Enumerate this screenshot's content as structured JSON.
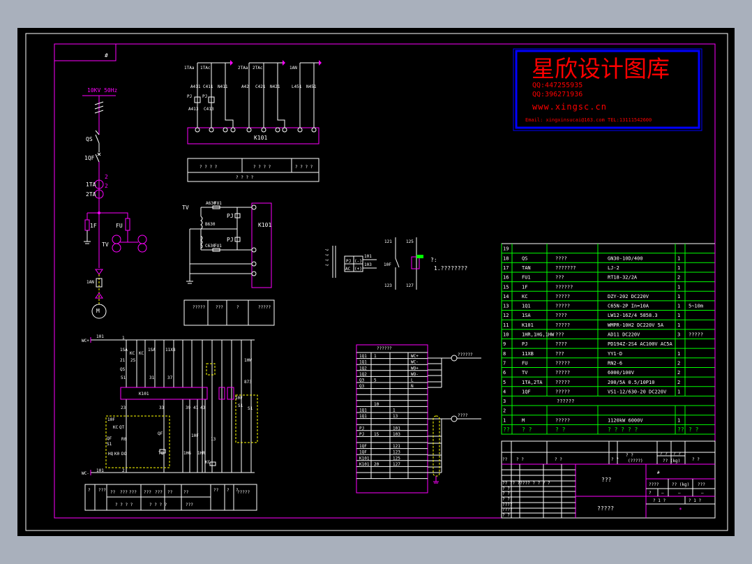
{
  "colors": {
    "background": "#a9b0bc",
    "canvas": "#000000",
    "frame": "#ff00ff",
    "lines": "#ffffff",
    "table_grid": "#00ff00",
    "watermark_text": "#ff0000",
    "watermark_border": "#0000ff",
    "dashed": "#ffff00"
  },
  "corner_label": "#",
  "watermark": {
    "title": "星欣设计图库",
    "qq1": "QQ:447255935",
    "qq2": "QQ:396271936",
    "url": "www.xingsc.cn",
    "contact": "Email: xingxinsucai@163.com   TEL:13111542600"
  },
  "single_line": {
    "bus": "10KV   50Hz",
    "qs": "QS",
    "qf": "1QF",
    "ta1": "1TA",
    "ta2": "2TA",
    "ta_n1": "2",
    "ta_n2": "2",
    "f1": "1F",
    "fu": "FU",
    "tv": "TV",
    "an": "1AN",
    "motor": "M"
  },
  "current_circuit": {
    "labels": [
      "1TAa",
      "1TAc",
      "2TAa",
      "2TAc",
      "1AN"
    ],
    "wires": [
      "A411",
      "C411",
      "N411",
      "A42",
      "C421",
      "N421",
      "L451",
      "N451"
    ],
    "pj": [
      "PJ",
      "PJ"
    ],
    "wires2": [
      "A413",
      "C413"
    ],
    "terminal_box": "K101",
    "table_row1": [
      "? ? ? ?",
      "? ? ? ?",
      "? ? ? ?"
    ],
    "table_row2": "? ? ? ?"
  },
  "voltage_circuit": {
    "tv": "TV",
    "wires": [
      "A630",
      "B630",
      "C630"
    ],
    "fu": [
      "FU1",
      "FU1"
    ],
    "pj": [
      "PJ",
      "PJ"
    ],
    "terminal_box": "K101",
    "table": [
      "?????",
      "???",
      "?",
      "?????"
    ]
  },
  "meter": {
    "side": "?  ?  ?  ?",
    "pj": "PJ",
    "ac": "AC",
    "minus": "(-)",
    "plus": "(+)",
    "w1": "101",
    "w2": "103",
    "contact_label": "10F",
    "n121": "121",
    "n123": "123",
    "n125": "125",
    "n127": "127",
    "note_title": "?:",
    "note_1": "1.????????"
  },
  "control_circuit": {
    "top_bus": "WC+",
    "bottom_bus": "WC-",
    "n101a": "101",
    "n101b": "101",
    "n1": "1",
    "n2": "2",
    "labels": [
      "1SA",
      "KC",
      "KC",
      "1SA",
      "11XB",
      "21",
      "25",
      "QS",
      "51",
      "31",
      "37",
      "K101",
      "23",
      "33",
      "39",
      "41",
      "43",
      "10F",
      "KC",
      "QT",
      "QF",
      "S1",
      "R0",
      "HQ",
      "K0",
      "DO",
      "QF",
      "TQ",
      "1HG",
      "1HR",
      "KC",
      "10F",
      "13",
      "1HW",
      "873",
      "S1",
      "S1",
      "10F"
    ],
    "table_row1": [
      "?",
      "???",
      "??",
      "???",
      "???",
      "???",
      "???",
      "??",
      "??",
      "??",
      "?",
      "?",
      "?????"
    ],
    "table_row2": [
      "? ? ? ?",
      "? ? ? ?",
      "???"
    ]
  },
  "terminal_table": {
    "title": "??????",
    "rows": [
      [
        "1Q1",
        "1",
        "",
        "WC+"
      ],
      [
        "1Q1",
        "",
        "",
        "WC-"
      ],
      [
        "1Q2",
        "",
        "",
        "WO+"
      ],
      [
        "1Q2",
        "",
        "",
        "WO-"
      ],
      [
        "Q3",
        "5",
        "",
        "L"
      ],
      [
        "Q3",
        "",
        "",
        "N"
      ],
      [
        "",
        "",
        "",
        ""
      ],
      [
        "",
        "",
        "",
        ""
      ],
      [
        "",
        "10",
        "",
        ""
      ],
      [
        "1Q1",
        "",
        "1",
        ""
      ],
      [
        "1Q1",
        "",
        "13",
        ""
      ],
      [
        "",
        "",
        "",
        ""
      ],
      [
        "PJ",
        "",
        "101",
        ""
      ],
      [
        "PJ",
        "15",
        "103",
        ""
      ],
      [
        "",
        "",
        "",
        ""
      ],
      [
        "1QF",
        "",
        "121",
        ""
      ],
      [
        "1QF",
        "",
        "123",
        ""
      ],
      [
        "K101",
        "",
        "125",
        ""
      ],
      [
        "K101",
        "20",
        "127",
        ""
      ],
      [
        "",
        "",
        "",
        ""
      ],
      [
        "",
        "",
        "",
        ""
      ]
    ],
    "cable1": "??????",
    "cable2": "????"
  },
  "bom": {
    "rows": [
      [
        "19",
        "",
        "",
        "",
        "",
        ""
      ],
      [
        "18",
        "QS",
        "????",
        "GN30-10D/400",
        "1",
        ""
      ],
      [
        "17",
        "TAN",
        "???????",
        "LJ-2",
        "1",
        ""
      ],
      [
        "16",
        "FU1",
        "???",
        "RT18-32/2A",
        "2",
        ""
      ],
      [
        "15",
        "1F",
        "??????",
        "",
        "1",
        ""
      ],
      [
        "14",
        "KC",
        "?????",
        "DZY-202   DC220V",
        "1",
        ""
      ],
      [
        "13",
        "1Q1",
        "?????",
        "C65N-2P   In=10A",
        "1",
        "5~10m"
      ],
      [
        "12",
        "1SA",
        "????",
        "LW12-16Z/4 5858.3",
        "1",
        ""
      ],
      [
        "11",
        "K101",
        "?????",
        "WMPR-10H2 DC220V 5A",
        "1",
        ""
      ],
      [
        "10",
        "1HR,1HG,1HW",
        "???",
        "AD11   DC220V",
        "3",
        "?????"
      ],
      [
        "9",
        "PJ",
        "????",
        "PD194Z-2S4 AC100V AC5A",
        "",
        ""
      ],
      [
        "8",
        "11XB",
        "???",
        "YY1-D",
        "1",
        ""
      ],
      [
        "7",
        "FU",
        "?????",
        "RN2-6",
        "2",
        ""
      ],
      [
        "6",
        "TV",
        "?????",
        "6000/100V",
        "2",
        ""
      ],
      [
        "5",
        "1TA,2TA",
        "?????",
        "200/5A 0.5/10P10",
        "2",
        ""
      ],
      [
        "4",
        "1QF",
        "?????",
        "VS1-12/630-20 DC220V",
        "1",
        ""
      ],
      [
        "3",
        "??????",
        "",
        "",
        "",
        ""
      ],
      [
        "2",
        "",
        "",
        "",
        "",
        ""
      ],
      [
        "1",
        "M",
        "?????",
        "1120kW            6000V",
        "1",
        ""
      ]
    ],
    "header": [
      "??",
      "?   ?",
      "?   ?",
      "? ? ? ? ?",
      "??",
      "?  ?"
    ]
  },
  "title_block": {
    "hdr": [
      "??",
      "?      ?",
      "?            ?",
      "?\n?",
      "?      ?",
      "(????)",
      "? ?",
      "? ?",
      "?? (kg)",
      "?  ?"
    ],
    "left_rows": [
      "?? ?? ????? ? ? ? ?",
      "? ?",
      "? ?",
      "? ?",
      "????",
      "????",
      "? ?"
    ],
    "name1": "???",
    "name2": "?????",
    "mark": "#",
    "weight_hdr": [
      "????",
      "?? (kg)",
      "???"
    ],
    "weight_vals": [
      "?",
      "—",
      "—",
      "—"
    ],
    "sheet": [
      "?  1  ?",
      "?  1  ?"
    ],
    "company": "*"
  }
}
